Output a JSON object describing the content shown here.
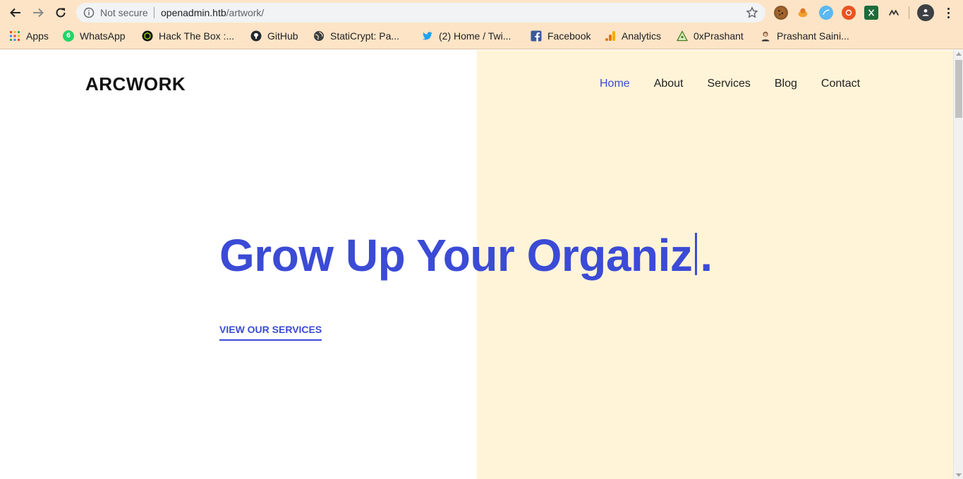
{
  "browser": {
    "security_label": "Not secure",
    "url_host": "openadmin.htb",
    "url_path": "/artwork/",
    "extensions": [
      "cookie-icon",
      "hacker-icon",
      "swirl-icon",
      "ubuntu-icon",
      "excel-icon",
      "wappalyzer-icon"
    ]
  },
  "bookmarks": [
    {
      "label": "Apps",
      "icon": "apps-grid-icon"
    },
    {
      "label": "WhatsApp",
      "icon": "whatsapp-icon",
      "badge": "6"
    },
    {
      "label": "Hack The Box :...",
      "icon": "hackthebox-icon"
    },
    {
      "label": "GitHub",
      "icon": "github-icon"
    },
    {
      "label": "StatiCrypt: Pa...",
      "icon": "globe-icon"
    },
    {
      "label": "(2) Home / Twi...",
      "icon": "twitter-icon"
    },
    {
      "label": "Facebook",
      "icon": "facebook-icon"
    },
    {
      "label": "Analytics",
      "icon": "analytics-icon"
    },
    {
      "label": "0xPrashant",
      "icon": "pyramid-icon"
    },
    {
      "label": "Prashant Saini...",
      "icon": "person-avatar-icon"
    }
  ],
  "site": {
    "brand": "ARCWORK",
    "nav": [
      "Home",
      "About",
      "Services",
      "Blog",
      "Contact"
    ],
    "active_nav": "Home"
  },
  "hero": {
    "title_text": "Grow Up Your Organiz",
    "title_end": ".",
    "cta_label": "VIEW OUR SERVICES"
  },
  "colors": {
    "accent": "#3b4bd6",
    "panel": "#fff4d8",
    "chrome": "#fde4c6"
  }
}
